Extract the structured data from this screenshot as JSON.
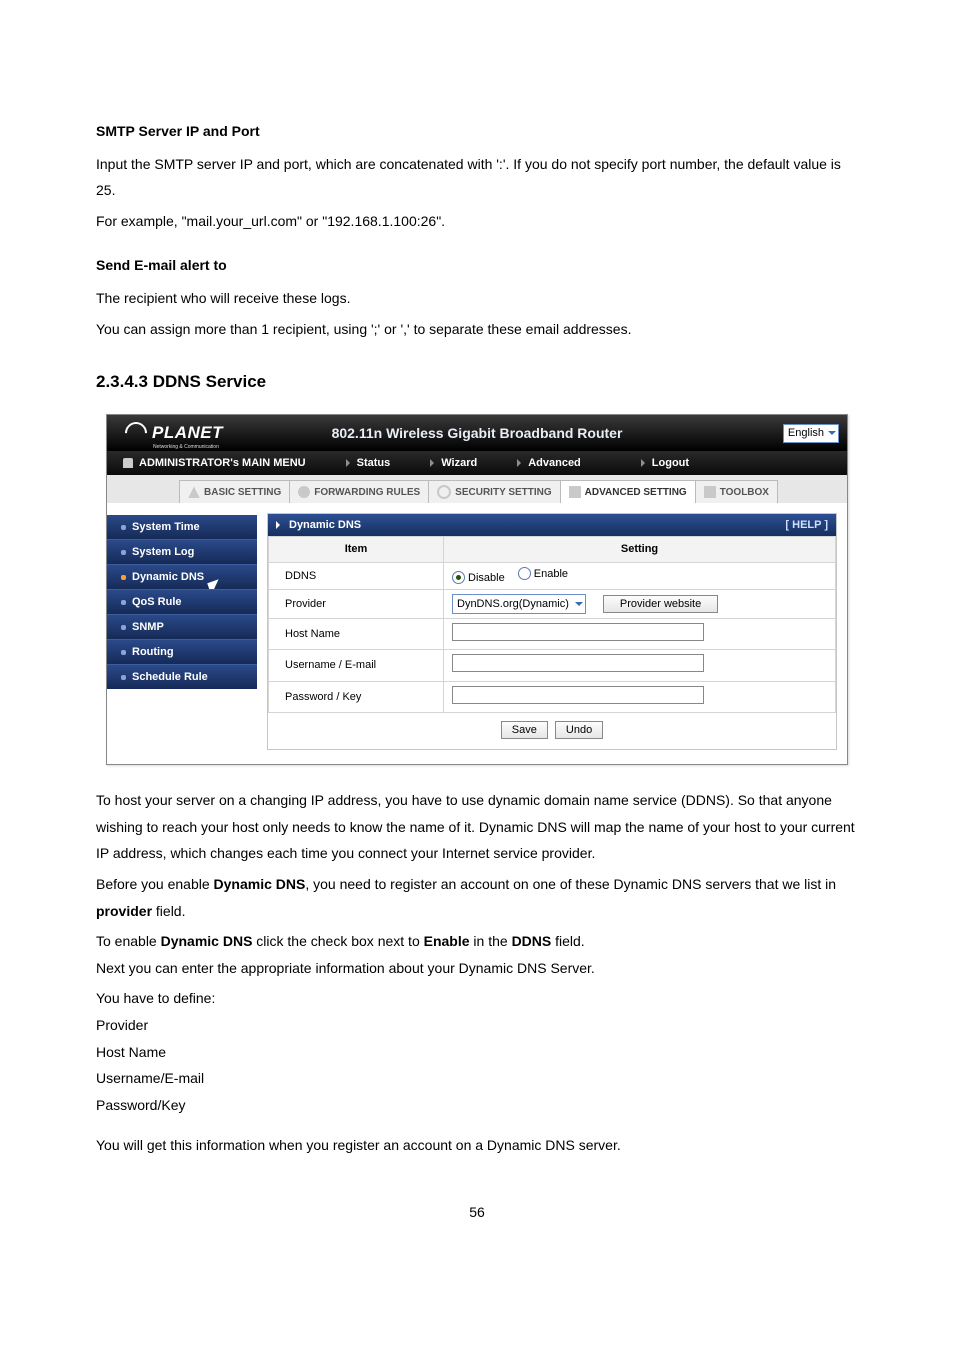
{
  "doc": {
    "h1": "SMTP Server IP and Port",
    "p1": "Input the SMTP server IP and port, which are concatenated with ':'. If you do not specify port number, the default value is 25.",
    "p2": "For example, \"mail.your_url.com\" or \"192.168.1.100:26\".",
    "h2": "Send E-mail alert to",
    "p3": "The recipient who will receive these logs.",
    "p4": "You can assign more than 1 recipient, using ';' or ',' to separate these email addresses.",
    "section": "2.3.4.3 DDNS Service",
    "after1": "To host your server on a changing IP address, you have to use dynamic domain name service (DDNS). So that anyone wishing to reach your host only needs to know the name of it. Dynamic DNS will map the name of your host to your current IP address, which changes each time you connect your Internet service provider.",
    "after2a": "Before you enable ",
    "after2b": "Dynamic DNS",
    "after2c": ", you need to register an account on one of these Dynamic DNS servers that we list in ",
    "after2d": "provider",
    "after2e": " field.",
    "after3a": "To enable ",
    "after3b": "Dynamic DNS",
    "after3c": " click the check box next to ",
    "after3d": "Enable",
    "after3e": " in the ",
    "after3f": "DDNS",
    "after3g": " field.",
    "after4": "Next you can enter the appropriate information about your Dynamic DNS Server.",
    "define_intro": "You have to define:",
    "define": [
      "Provider",
      "Host Name",
      "Username/E-mail",
      "Password/Key"
    ],
    "after5": "You will get this information when you register an account on a Dynamic DNS server.",
    "page_number": "56"
  },
  "ui": {
    "logo_text": "PLANET",
    "logo_sub": "Networking & Communication",
    "banner_title": "802.11n Wireless Gigabit Broadband Router",
    "language": "English",
    "admin_menu_label": "ADMINISTRATOR's MAIN MENU",
    "menu": {
      "status": "Status",
      "wizard": "Wizard",
      "advanced": "Advanced",
      "logout": "Logout"
    },
    "tabs": {
      "basic": "BASIC SETTING",
      "forwarding": "FORWARDING RULES",
      "security": "SECURITY SETTING",
      "advanced": "ADVANCED SETTING",
      "toolbox": "TOOLBOX"
    },
    "sidebar": {
      "system_time": "System Time",
      "system_log": "System Log",
      "dynamic_dns": "Dynamic DNS",
      "qos_rule": "QoS Rule",
      "snmp": "SNMP",
      "routing": "Routing",
      "schedule_rule": "Schedule Rule"
    },
    "panel": {
      "title": "Dynamic DNS",
      "help": "[ HELP ]",
      "col_item": "Item",
      "col_setting": "Setting",
      "rows": {
        "ddns_label": "DDNS",
        "disable": "Disable",
        "enable": "Enable",
        "provider_label": "Provider",
        "provider_select": "DynDNS.org(Dynamic)",
        "provider_button": "Provider website",
        "hostname_label": "Host Name",
        "username_label": "Username / E-mail",
        "password_label": "Password / Key"
      },
      "save": "Save",
      "undo": "Undo"
    }
  }
}
